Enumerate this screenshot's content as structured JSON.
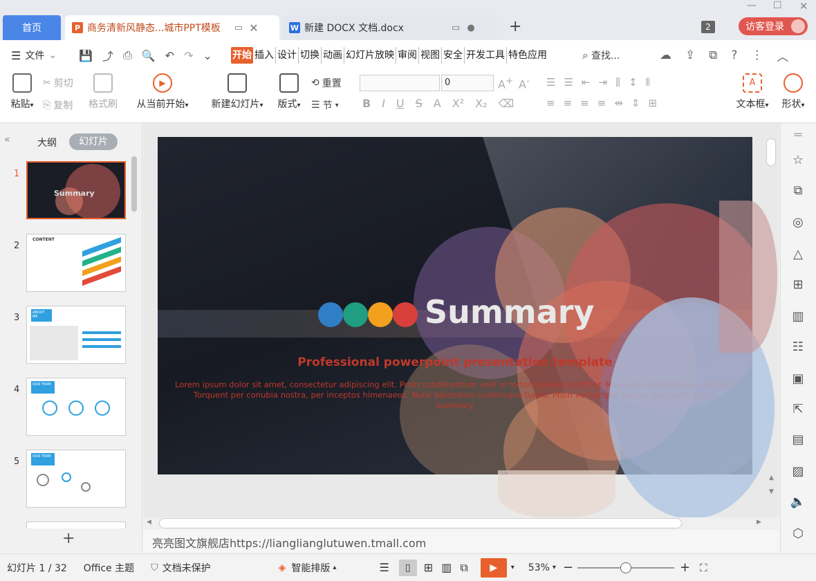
{
  "tabs": {
    "home": "首页",
    "doc1": "商务清新风静态...城市PPT模板",
    "doc2": "新建 DOCX 文档.docx",
    "doc1_icon": "P",
    "doc2_icon": "W",
    "counter": "2",
    "login": "访客登录"
  },
  "menu": {
    "file": "文件",
    "items": [
      "开始",
      "插入",
      "设计",
      "切换",
      "动画",
      "幻灯片放映",
      "审阅",
      "视图",
      "安全",
      "开发工具",
      "特色应用"
    ],
    "search": "查找..."
  },
  "ribbon": {
    "paste": "粘贴",
    "cut": "剪切",
    "copy": "复制",
    "format_painter": "格式刷",
    "play_from_current": "从当前开始",
    "new_slide": "新建幻灯片",
    "layout": "版式",
    "reset": "重置",
    "section": "节",
    "font_size": "0",
    "textbox": "文本框",
    "shape": "形状"
  },
  "side": {
    "outline": "大纲",
    "slides": "幻灯片",
    "numbers": [
      "1",
      "2",
      "3",
      "4",
      "5"
    ]
  },
  "slide": {
    "title": "Summary",
    "subtitle": "Professional powerpoint presentation template",
    "body1": "Lorem ipsum dolor sit amet, consectetur adipiscing elit. Proin condimentum velit in tortor posuere porttitor. Maecenas pellentesque ad litora",
    "body2": "Torquent per conubia nostra, per inceptos himenaeos. Nunc bibendum scelerisque turpis. Proin vel semper augue, nec porta tellus.",
    "body3": "summary",
    "dots": [
      "#2f7ec6",
      "#1f9e82",
      "#f2a01e",
      "#d8403c"
    ]
  },
  "thumbs": {
    "t1": "Summary",
    "t2": "CONTENT",
    "t3": "ABOUT ME",
    "t4": "OUR TEAM",
    "t5": "OUR TEAM"
  },
  "notes": "亮亮图文旗舰店https://lianglianglutuwen.tmall.com",
  "status": {
    "slide": "幻灯片 1 / 32",
    "theme": "Office 主题",
    "protect": "文档未保护",
    "smart": "智能排版",
    "zoom": "53%"
  }
}
